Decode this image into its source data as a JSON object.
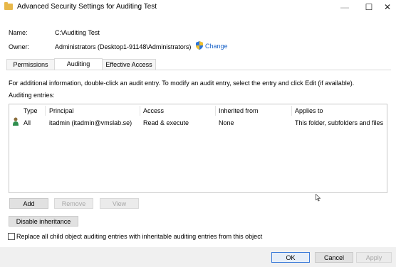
{
  "window": {
    "title": "Advanced Security Settings for Auditing Test",
    "minimize_glyph": "—",
    "maximize_glyph": "☐",
    "close_glyph": "✕"
  },
  "object": {
    "name_label": "Name:",
    "name_value": "C:\\Auditing Test",
    "owner_label": "Owner:",
    "owner_value": "Administrators (Desktop1-91148\\Administrators)",
    "change_link": "Change"
  },
  "tabs": [
    {
      "label": "Permissions",
      "active": false
    },
    {
      "label": "Auditing",
      "active": true
    },
    {
      "label": "Effective Access",
      "active": false
    }
  ],
  "auditing": {
    "info_text": "For additional information, double-click an audit entry. To modify an audit entry, select the entry and click Edit (if available).",
    "entries_label": "Auditing entries:",
    "columns": [
      "Type",
      "Principal",
      "Access",
      "Inherited from",
      "Applies to"
    ],
    "rows": [
      {
        "icon": "user-icon",
        "type": "All",
        "principal": "itadmin (itadmin@vmslab.se)",
        "access": "Read & execute",
        "inherited_from": "None",
        "applies_to": "This folder, subfolders and files"
      }
    ]
  },
  "buttons": {
    "add": "Add",
    "remove": "Remove",
    "view": "View",
    "disable_inheritance": "Disable inheritance",
    "ok": "OK",
    "cancel": "Cancel",
    "apply": "Apply"
  },
  "replace_checkbox": {
    "label": "Replace all child object auditing entries with inheritable auditing entries from this object",
    "checked": false
  },
  "colors": {
    "link": "#1b64c8",
    "folder": "#e8b84a",
    "footer": "#f0f0f0",
    "primary_border": "#3b7bd9"
  }
}
